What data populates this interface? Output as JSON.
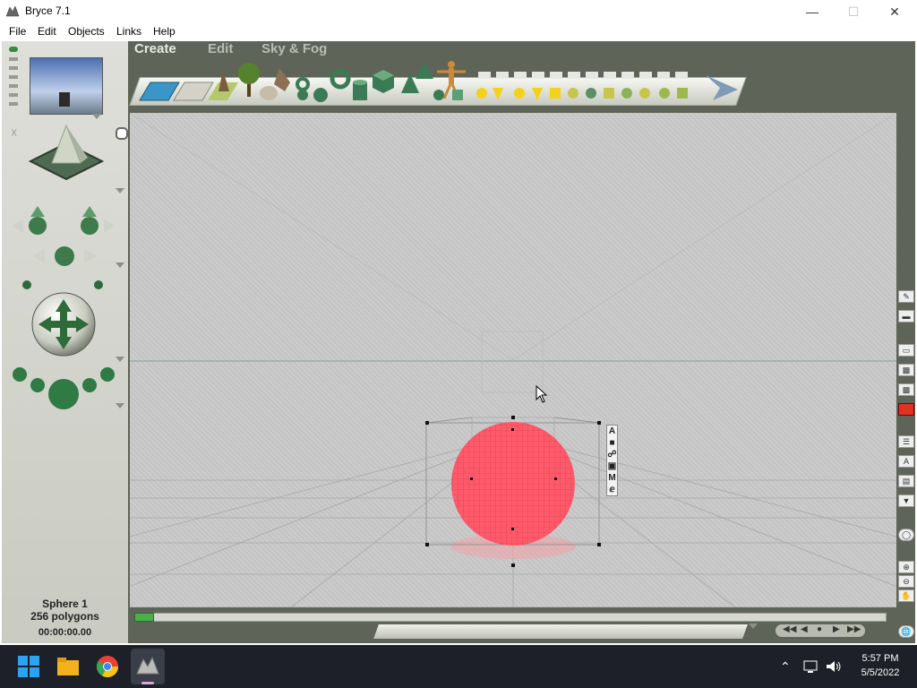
{
  "window": {
    "title": "Bryce 7.1",
    "minimize_icon": "minimize-icon",
    "maximize_icon": "maximize-icon",
    "close_icon": "close-icon"
  },
  "menu": {
    "items": [
      "File",
      "Edit",
      "Objects",
      "Links",
      "Help"
    ]
  },
  "palette_tabs": [
    "Create",
    "Edit",
    "Sky & Fog"
  ],
  "active_tab": "Create",
  "create_shelf_icons": [
    "water-plane-icon",
    "ground-plane-icon",
    "terrain-icon",
    "tree-icon",
    "rock-icon",
    "stone-icon",
    "torus-icon",
    "cylinder-icon",
    "cube-icon",
    "pyramid-icon",
    "cone-icon",
    "human-figure-icon",
    "primitive-icons",
    "light-icons"
  ],
  "selection": {
    "name": "Sphere 1",
    "polygons": "256 polygons",
    "time": "00:00:00.00"
  },
  "object_toolbar_letters": [
    "A",
    "M"
  ],
  "taskbar": {
    "apps": [
      "windows-start-icon",
      "file-explorer-icon",
      "chrome-icon",
      "bryce-icon"
    ],
    "time": "5:57 PM",
    "date": "5/5/2022"
  },
  "colors": {
    "workspace": "#5e6458",
    "viewport": "#c9c9c9",
    "sphere": "#ff5a6a",
    "taskbar": "#1d2028"
  }
}
